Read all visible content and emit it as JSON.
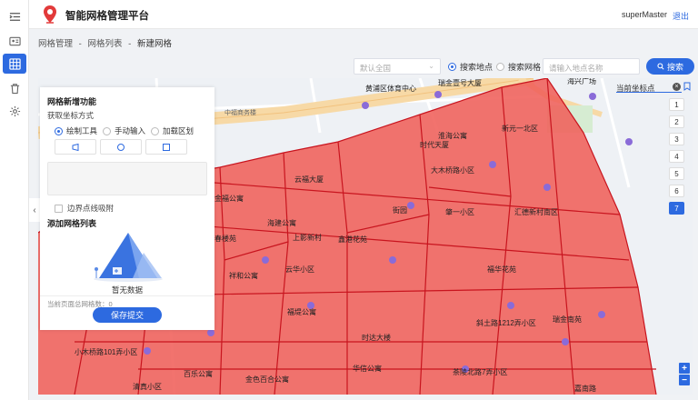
{
  "header": {
    "app_title": "智能网格管理平台",
    "user": "superMaster",
    "logout": "退出"
  },
  "breadcrumb": {
    "items": [
      "网格管理",
      "-",
      "网格列表",
      "-",
      "新建网格"
    ]
  },
  "search": {
    "region_placeholder": "默认全国",
    "option_place": "搜索地点",
    "option_grid": "搜索网格",
    "input_placeholder": "请输入地点名称",
    "button": "搜索"
  },
  "map_overlay": {
    "current_coord": "当前坐标点",
    "close": "×"
  },
  "pages": [
    "1",
    "2",
    "3",
    "4",
    "5",
    "6",
    "7"
  ],
  "active_page": "7",
  "zoom": {
    "in": "+",
    "out": "−"
  },
  "panel": {
    "title": "网格新增功能",
    "subtitle": "获取坐标方式",
    "modes": [
      "绘制工具",
      "手动输入",
      "加载区划"
    ],
    "selected_mode": "绘制工具",
    "snap_label": "边界点线吸附",
    "list_title": "添加网格列表",
    "empty_text": "暂无数据",
    "count_label": "当前页面总网格数：0",
    "submit": "保存提交"
  },
  "collapse": "‹",
  "map_labels": [
    {
      "text": "黄浦区体育中心"
    },
    {
      "text": "瑞金壹号大厦"
    },
    {
      "text": "海兴广场"
    },
    {
      "text": "中福商务楼"
    },
    {
      "text": "淮海公寓"
    },
    {
      "text": "新元一北区"
    },
    {
      "text": "时代天厦"
    },
    {
      "text": "大木桥路小区"
    },
    {
      "text": "云福大厦"
    },
    {
      "text": "金福公寓"
    },
    {
      "text": "街园"
    },
    {
      "text": "肇一小区"
    },
    {
      "text": "汇德新村南区"
    },
    {
      "text": "海建公寓"
    },
    {
      "text": "上影新村"
    },
    {
      "text": "鑫港花苑"
    },
    {
      "text": "春楼苑"
    },
    {
      "text": "祥和公寓"
    },
    {
      "text": "云华小区"
    },
    {
      "text": "福华花苑"
    },
    {
      "text": "福堤公寓"
    },
    {
      "text": "时达大楼"
    },
    {
      "text": "斜土路1212弄小区"
    },
    {
      "text": "瑞金南苑"
    },
    {
      "text": "小木桥路101弄小区"
    },
    {
      "text": "百乐公寓"
    },
    {
      "text": "华信公寓"
    },
    {
      "text": "清真小区"
    },
    {
      "text": "金色百合公寓"
    },
    {
      "text": "茶陵北路7弄小区"
    },
    {
      "text": "嘉南路"
    }
  ],
  "colors": {
    "accent": "#2d6ae0",
    "grid_fill": "#f0605a",
    "grid_line": "#c8141e",
    "road_yellow": "#f7d9a6"
  }
}
